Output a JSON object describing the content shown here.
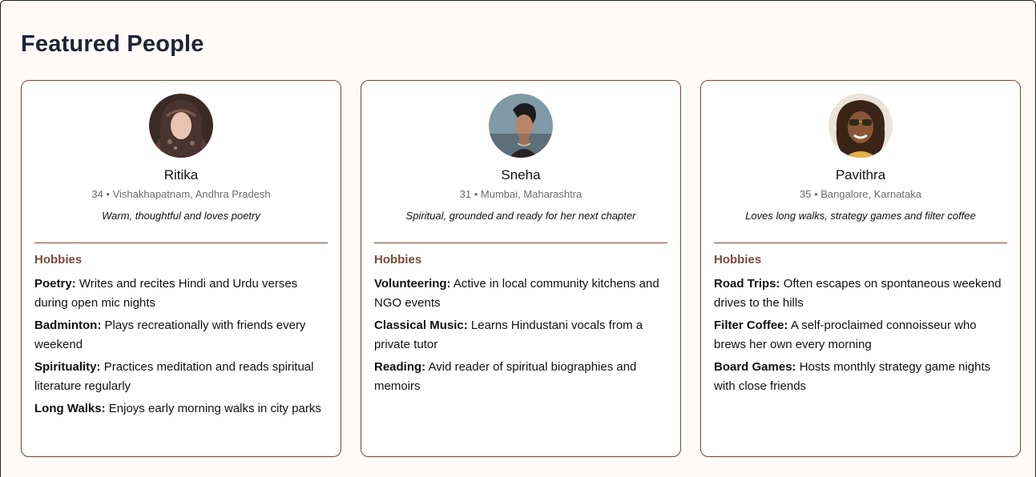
{
  "page_title": "Featured People",
  "hobbies_heading": "Hobbies",
  "people": [
    {
      "name": "Ritika",
      "meta": "34 • Vishakhapatnam, Andhra Pradesh",
      "tagline": "Warm, thoughtful and loves poetry",
      "hobbies": [
        {
          "title": "Poetry:",
          "desc": "Writes and recites Hindi and Urdu verses during open mic nights"
        },
        {
          "title": "Badminton:",
          "desc": "Plays recreationally with friends every weekend"
        },
        {
          "title": "Spirituality:",
          "desc": "Practices meditation and reads spiritual literature regularly"
        },
        {
          "title": "Long Walks:",
          "desc": "Enjoys early morning walks in city parks"
        }
      ]
    },
    {
      "name": "Sneha",
      "meta": "31 • Mumbai, Maharashtra",
      "tagline": "Spiritual, grounded and ready for her next chapter",
      "hobbies": [
        {
          "title": "Volunteering:",
          "desc": "Active in local community kitchens and NGO events"
        },
        {
          "title": "Classical Music:",
          "desc": "Learns Hindustani vocals from a private tutor"
        },
        {
          "title": "Reading:",
          "desc": "Avid reader of spiritual biographies and memoirs"
        }
      ]
    },
    {
      "name": "Pavithra",
      "meta": "35 • Bangalore, Karnataka",
      "tagline": "Loves long walks, strategy games and filter coffee",
      "hobbies": [
        {
          "title": "Road Trips:",
          "desc": "Often escapes on spontaneous weekend drives to the hills"
        },
        {
          "title": "Filter Coffee:",
          "desc": "A self-proclaimed connoisseur who brews her own every morning"
        },
        {
          "title": "Board Games:",
          "desc": "Hosts monthly strategy game nights with close friends"
        }
      ]
    }
  ],
  "colors": {
    "accent": "#7a4a3a",
    "title": "#1e2433",
    "background": "#fffaf8"
  }
}
